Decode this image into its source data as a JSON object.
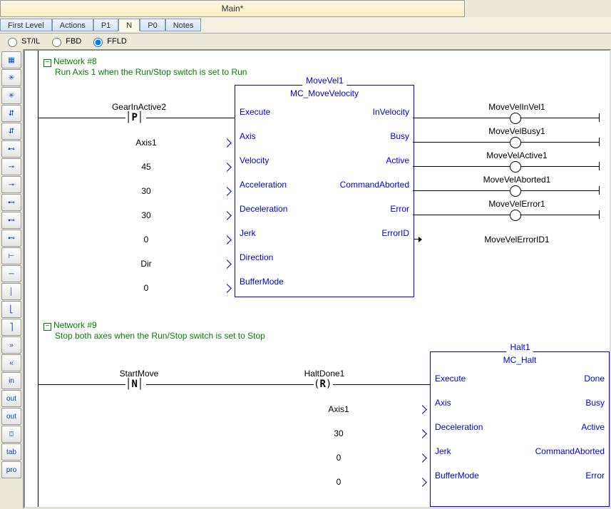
{
  "title": "Main*",
  "tabs": [
    "First Level",
    "Actions",
    "P1",
    "N",
    "P0",
    "Notes"
  ],
  "active_tab": "N",
  "view_modes": {
    "opt1": "ST/IL",
    "opt2": "FBD",
    "opt3": "FFLD",
    "selected": "FFLD"
  },
  "toolbox": [
    "▦",
    "✳",
    "✳",
    "⇵",
    "⇵",
    "⊷",
    "⊸",
    "⊸",
    "⊷",
    "⊷",
    "⊷",
    "⊢",
    "─",
    "│",
    "⎣",
    "⎤",
    "»",
    "«",
    "in",
    "out",
    "out",
    "⌼",
    "tab",
    "pro"
  ],
  "net8": {
    "title": "Network #8",
    "comment": "Run Axis 1 when the Run/Stop switch is set to Run",
    "contact_label": "GearInActive2",
    "contact_type": "P",
    "fb_instance": "MoveVel1",
    "fb_type": "MC_MoveVelocity",
    "inputs": [
      {
        "pin": "Execute",
        "val": ""
      },
      {
        "pin": "Axis",
        "val": "Axis1"
      },
      {
        "pin": "Velocity",
        "val": "45"
      },
      {
        "pin": "Acceleration",
        "val": "30"
      },
      {
        "pin": "Deceleration",
        "val": "30"
      },
      {
        "pin": "Jerk",
        "val": "0"
      },
      {
        "pin": "Direction",
        "val": "Dir"
      },
      {
        "pin": "BufferMode",
        "val": "0"
      }
    ],
    "outputs": [
      {
        "pin": "InVelocity",
        "coil": "MoveVelInVel1"
      },
      {
        "pin": "Busy",
        "coil": "MoveVelBusy1"
      },
      {
        "pin": "Active",
        "coil": "MoveVelActive1"
      },
      {
        "pin": "CommandAborted",
        "coil": "MoveVelAborted1"
      },
      {
        "pin": "Error",
        "coil": "MoveVelError1"
      },
      {
        "pin": "ErrorID",
        "coil": "MoveVelErrorID1"
      }
    ]
  },
  "net9": {
    "title": "Network #9",
    "comment": "Stop both axes when the Run/Stop switch is set to Stop",
    "contact1_label": "StartMove",
    "contact1_type": "N",
    "contact2_label": "HaltDone1",
    "contact2_type": "R",
    "fb_instance": "Halt1",
    "fb_type": "MC_Halt",
    "inputs": [
      {
        "pin": "Execute",
        "val": ""
      },
      {
        "pin": "Axis",
        "val": "Axis1"
      },
      {
        "pin": "Deceleration",
        "val": "30"
      },
      {
        "pin": "Jerk",
        "val": "0"
      },
      {
        "pin": "BufferMode",
        "val": "0"
      }
    ],
    "outputs": [
      {
        "pin": "Done"
      },
      {
        "pin": "Busy"
      },
      {
        "pin": "Active"
      },
      {
        "pin": "CommandAborted"
      },
      {
        "pin": "Error"
      }
    ]
  }
}
